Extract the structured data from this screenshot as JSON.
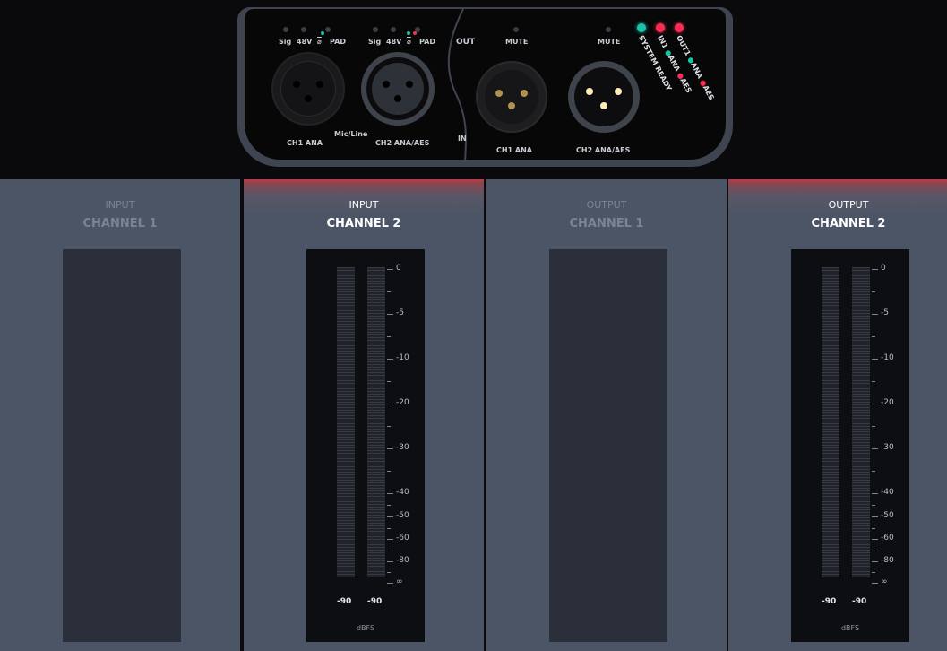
{
  "device": {
    "input_labels": {
      "sig": "Sig",
      "p48v": "48V",
      "phase": "⌀",
      "pad": "PAD"
    },
    "out_label": "OUT",
    "in_label": "IN",
    "mute_label": "MUTE",
    "mic_line_label": "Mic/Line",
    "connectors": {
      "in_ch1": "CH1 ANA",
      "in_ch2": "CH2 ANA/AES",
      "out_ch1": "CH1 ANA",
      "out_ch2": "CH2 ANA/AES"
    },
    "status": {
      "system_ready": "SYSTEM READY",
      "in1": "IN1",
      "in_ana": "ANA",
      "in_aes": "AES",
      "out1": "OUT1",
      "out_ana": "ANA",
      "out_aes": "AES"
    },
    "colors": {
      "green": "#19c3a6",
      "red": "#ff2d55",
      "pin_dim": "#b09150",
      "pin_bright": "#ffecb8"
    }
  },
  "panels": [
    {
      "line1": "INPUT",
      "line2": "CHANNEL 1",
      "active": false
    },
    {
      "line1": "INPUT",
      "line2": "CHANNEL 2",
      "active": true
    },
    {
      "line1": "OUTPUT",
      "line2": "CHANNEL 1",
      "active": false
    },
    {
      "line1": "OUTPUT",
      "line2": "CHANNEL 2",
      "active": true
    }
  ],
  "meter": {
    "scale": [
      "0",
      "-5",
      "-10",
      "-20",
      "-30",
      "-40",
      "-50",
      "-60",
      "-80",
      "∞"
    ],
    "peak_left": "-90",
    "peak_right": "-90",
    "unit": "dBFS"
  },
  "accent_color": "#c23a47"
}
